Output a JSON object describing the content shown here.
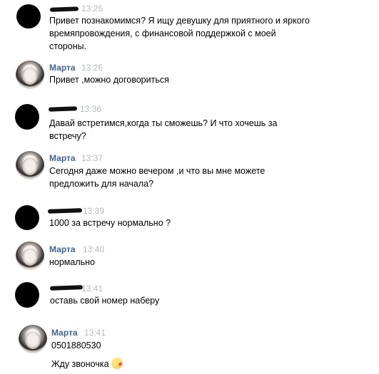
{
  "messages": [
    {
      "author": "",
      "time": "13:25",
      "redacted": true,
      "lines": [
        "Привет познакомимся? Я ищу девушку для приятного и яркого",
        "времяпровождения, с финансовой поддержкой с моей",
        "стороны."
      ]
    },
    {
      "author": "Марта",
      "time": "13:26",
      "redacted": false,
      "lines": [
        "Привет ,можно договориться"
      ]
    },
    {
      "author": "",
      "time": "13:36",
      "redacted": true,
      "lines": [
        "Давай встретимся,когда ты сможешь? И что хочешь за",
        "встречу?"
      ]
    },
    {
      "author": "Марта",
      "time": "13:37",
      "redacted": false,
      "lines": [
        "Сегодня даже можно вечером ,и что вы мне можете",
        "предложить для начала?"
      ]
    },
    {
      "author": "",
      "time": "13:39",
      "redacted": true,
      "lines": [
        "1000 за встречу нормально ?"
      ]
    },
    {
      "author": "Марта",
      "time": "13:40",
      "redacted": false,
      "lines": [
        "нормально"
      ]
    },
    {
      "author": "",
      "time": "13:41",
      "redacted": true,
      "lines": [
        "оставь свой номер наберу"
      ]
    },
    {
      "author": "Марта",
      "time": "13:41",
      "redacted": false,
      "lines": [
        "0501880530",
        "Жду звоночка"
      ]
    }
  ],
  "icons": {
    "emoji": "kiss-emoji-icon"
  }
}
